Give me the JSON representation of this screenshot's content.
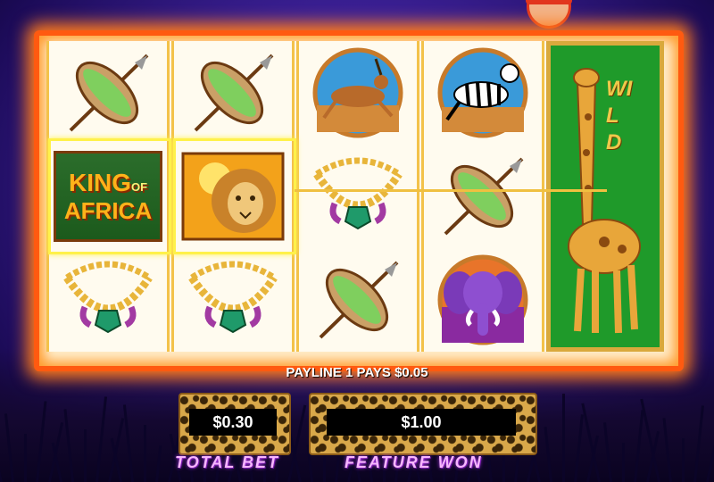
{
  "payline_message": "PAYLINE 1 PAYS $0.05",
  "total_bet": {
    "value": "$0.30",
    "label": "TOTAL BET"
  },
  "feature_won": {
    "value": "$1.00",
    "label": "FEATURE WON"
  },
  "logo_text": {
    "line1": "KING",
    "of": "OF",
    "line2": "AFRICA"
  },
  "wild_text": "WILD",
  "reels": [
    [
      "shield",
      "king-of-africa-logo",
      "necklace"
    ],
    [
      "shield",
      "lion",
      "necklace"
    ],
    [
      "gazelle",
      "necklace",
      "shield"
    ],
    [
      "zebra",
      "shield",
      "elephant"
    ],
    [
      "wild-giraffe"
    ]
  ],
  "winning_symbols": [
    "king-of-africa-logo",
    "lion"
  ],
  "colors": {
    "frame": "#ff5a10",
    "win_highlight": "#fff14a",
    "background": "#3a1f93",
    "label": "#f7b6ff"
  }
}
